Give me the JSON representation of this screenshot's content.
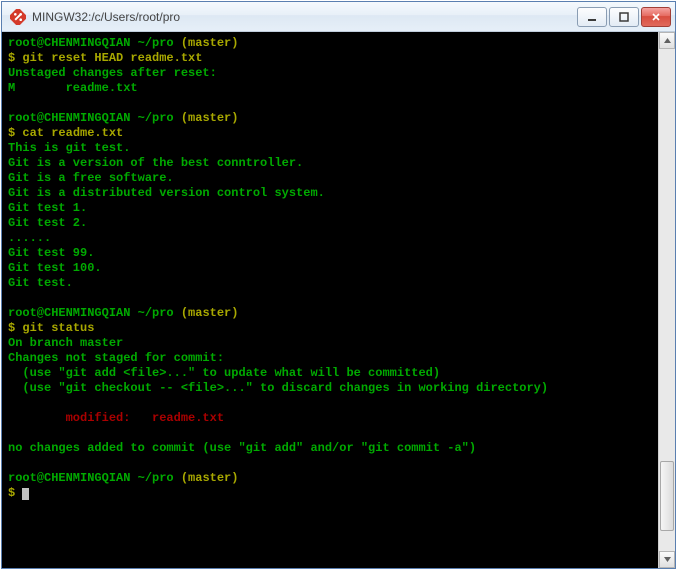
{
  "window": {
    "title": "MINGW32:/c/Users/root/pro"
  },
  "colors": {
    "prompt": "#00aa00",
    "branch": "#a8a800",
    "command": "#a8a800",
    "output_green": "#00aa00",
    "output_red": "#aa0000",
    "bg": "#000000"
  },
  "prompt": {
    "user_host_path": "root@CHENMINGQIAN ~/pro",
    "branch": "(master)",
    "symbol": "$ "
  },
  "sessions": [
    {
      "command": "git reset HEAD readme.txt",
      "output": [
        {
          "style": "green",
          "text": "Unstaged changes after reset:"
        },
        {
          "style": "green",
          "text": "M       readme.txt"
        }
      ]
    },
    {
      "command": "cat readme.txt",
      "output": [
        {
          "style": "green",
          "text": "This is git test."
        },
        {
          "style": "green",
          "text": "Git is a version of the best conntroller."
        },
        {
          "style": "green",
          "text": "Git is a free software."
        },
        {
          "style": "green",
          "text": "Git is a distributed version control system."
        },
        {
          "style": "green",
          "text": "Git test 1."
        },
        {
          "style": "green",
          "text": "Git test 2."
        },
        {
          "style": "green",
          "text": "......"
        },
        {
          "style": "green",
          "text": "Git test 99."
        },
        {
          "style": "green",
          "text": "Git test 100."
        },
        {
          "style": "green",
          "text": "Git test."
        }
      ]
    },
    {
      "command": "git status",
      "output": [
        {
          "style": "green",
          "text": "On branch master"
        },
        {
          "style": "green",
          "text": "Changes not staged for commit:"
        },
        {
          "style": "green",
          "text": "  (use \"git add <file>...\" to update what will be committed)"
        },
        {
          "style": "green",
          "text": "  (use \"git checkout -- <file>...\" to discard changes in working directory)"
        },
        {
          "style": "green",
          "text": ""
        },
        {
          "style": "red",
          "text": "        modified:   readme.txt"
        },
        {
          "style": "green",
          "text": ""
        },
        {
          "style": "green",
          "text": "no changes added to commit (use \"git add\" and/or \"git commit -a\")"
        }
      ]
    }
  ],
  "trailing_prompt": true,
  "scrollbar": {
    "thumb_top_pct": 82,
    "thumb_height_pct": 14
  }
}
